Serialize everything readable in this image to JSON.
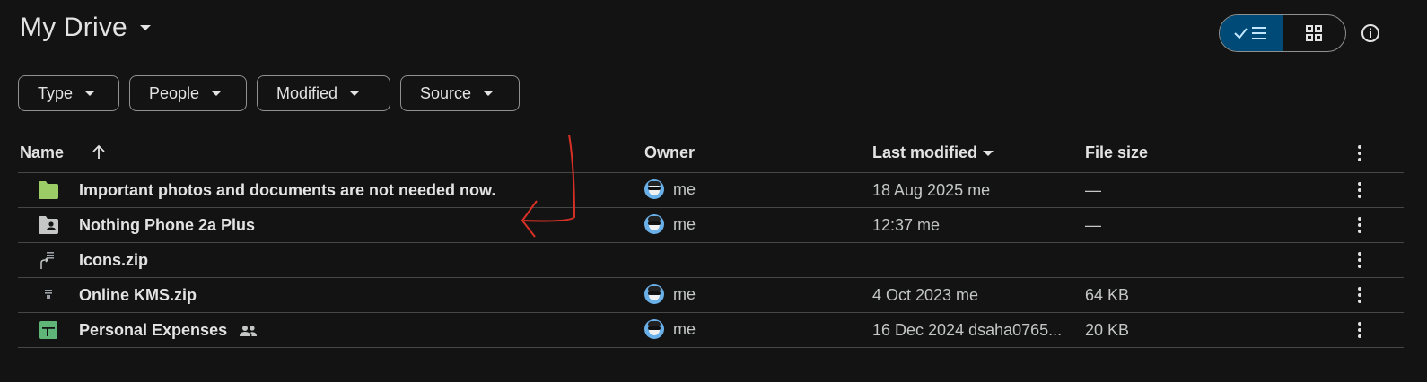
{
  "header": {
    "title": "My Drive"
  },
  "view_toggle": {
    "list_icon": "check-list-icon",
    "grid_icon": "grid-icon",
    "info_icon": "info-icon"
  },
  "filters": [
    {
      "label": "Type"
    },
    {
      "label": "People"
    },
    {
      "label": "Modified"
    },
    {
      "label": "Source"
    }
  ],
  "columns": {
    "name": "Name",
    "owner": "Owner",
    "last_modified": "Last modified",
    "file_size": "File size"
  },
  "rows": [
    {
      "name": "Important photos and documents are not needed now.",
      "icon": "folder-icon",
      "owner": "me",
      "modified": "18 Aug 2025 me",
      "size": "—"
    },
    {
      "name": "Nothing Phone 2a Plus",
      "icon": "shared-folder-icon",
      "owner": "me",
      "modified": "12:37 me",
      "size": "—"
    },
    {
      "name": "Icons.zip",
      "icon": "zip-shortcut-icon",
      "owner": "",
      "modified": "",
      "size": ""
    },
    {
      "name": "Online KMS.zip",
      "icon": "zip-icon",
      "owner": "me",
      "modified": "4 Oct 2023 me",
      "size": "64 KB"
    },
    {
      "name": "Personal Expenses",
      "icon": "sheets-icon",
      "owner": "me",
      "modified": "16 Dec 2024 dsaha0765...",
      "size": "20 KB"
    }
  ],
  "colors": {
    "background": "#131314",
    "toggle_active": "#004a77",
    "folder": "#9ccc65",
    "sheets": "#5fb577",
    "annotation": "#d93025"
  }
}
